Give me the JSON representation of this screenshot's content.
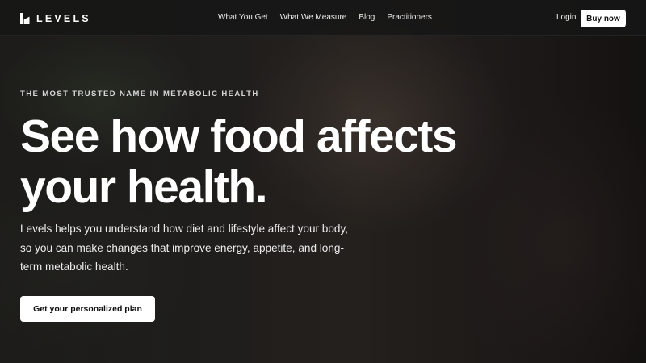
{
  "brand": {
    "logo_text": "LEVELS",
    "logo_icon": "levels-mark-icon"
  },
  "nav": {
    "links": [
      {
        "label": "What You Get"
      },
      {
        "label": "What We Measure"
      },
      {
        "label": "Blog"
      },
      {
        "label": "Practitioners"
      }
    ],
    "login_label": "Login",
    "buy_label": "Buy now"
  },
  "hero": {
    "eyebrow": "THE MOST TRUSTED NAME IN METABOLIC HEALTH",
    "headline_line1": "See how food affects",
    "headline_line2": "your health.",
    "description": "Levels helps you understand how diet and lifestyle affect your body, so you can make changes that improve energy, appetite, and long-term metabolic health.",
    "cta_label": "Get your personalized plan"
  },
  "colors": {
    "nav_background": "#161616",
    "button_background": "#ffffff",
    "button_text": "#111111",
    "text_primary": "#ffffff"
  }
}
